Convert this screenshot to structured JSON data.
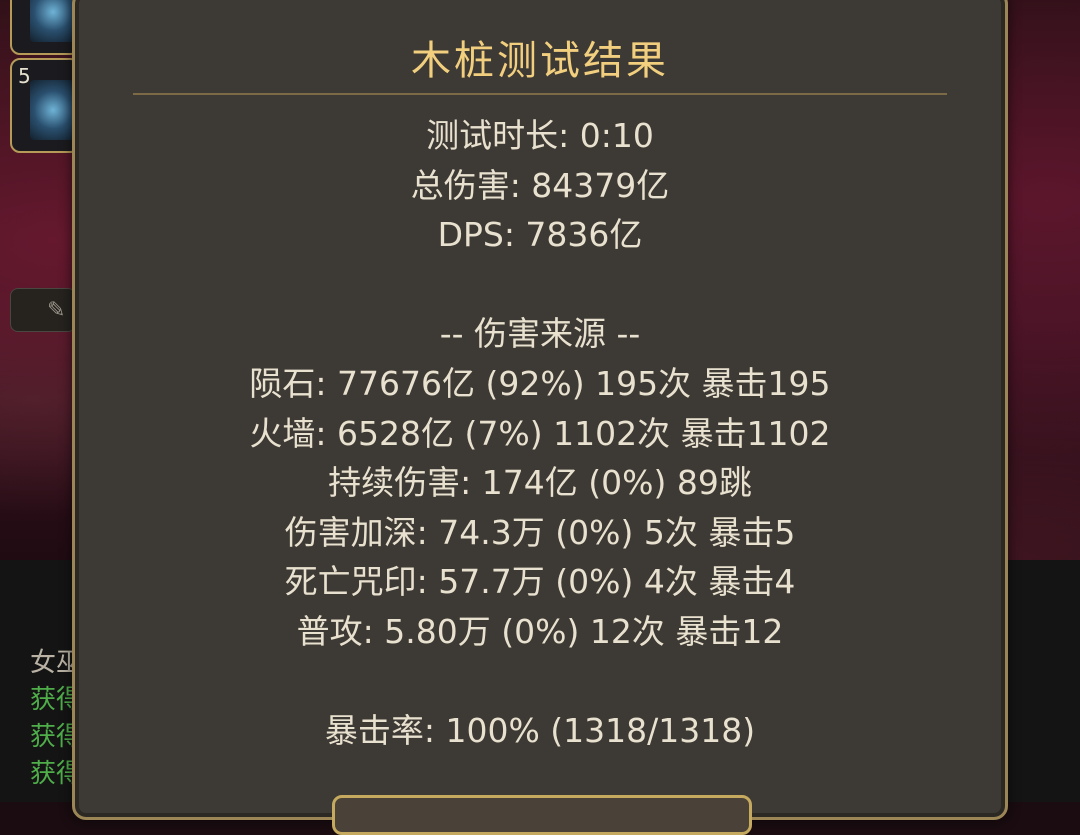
{
  "dialog": {
    "title": "木桩测试结果",
    "lines": [
      "测试时长: 0:10",
      "总伤害: 84379亿",
      "DPS: 7836亿",
      "",
      "-- 伤害来源 --",
      "陨石: 77676亿 (92%) 195次 暴击195",
      "火墙: 6528亿 (7%) 1102次 暴击1102",
      "持续伤害: 174亿 (0%) 89跳",
      "伤害加深: 74.3万 (0%) 5次 暴击5",
      "死亡咒印: 57.7万 (0%) 4次 暴击4",
      "普攻: 5.80万 (0%) 12次 暴击12",
      "",
      "暴击率: 100% (1318/1318)"
    ]
  },
  "left_panel": {
    "slot_number": "5",
    "log_lines": [
      "女巫",
      "获得",
      "获得",
      "获得"
    ]
  },
  "colors": {
    "title": "#f2cf7e",
    "text": "#e9e1cf",
    "dialog_bg": "#3d3934",
    "border_gold": "#9c8656",
    "log_green": "#4fae4a"
  }
}
